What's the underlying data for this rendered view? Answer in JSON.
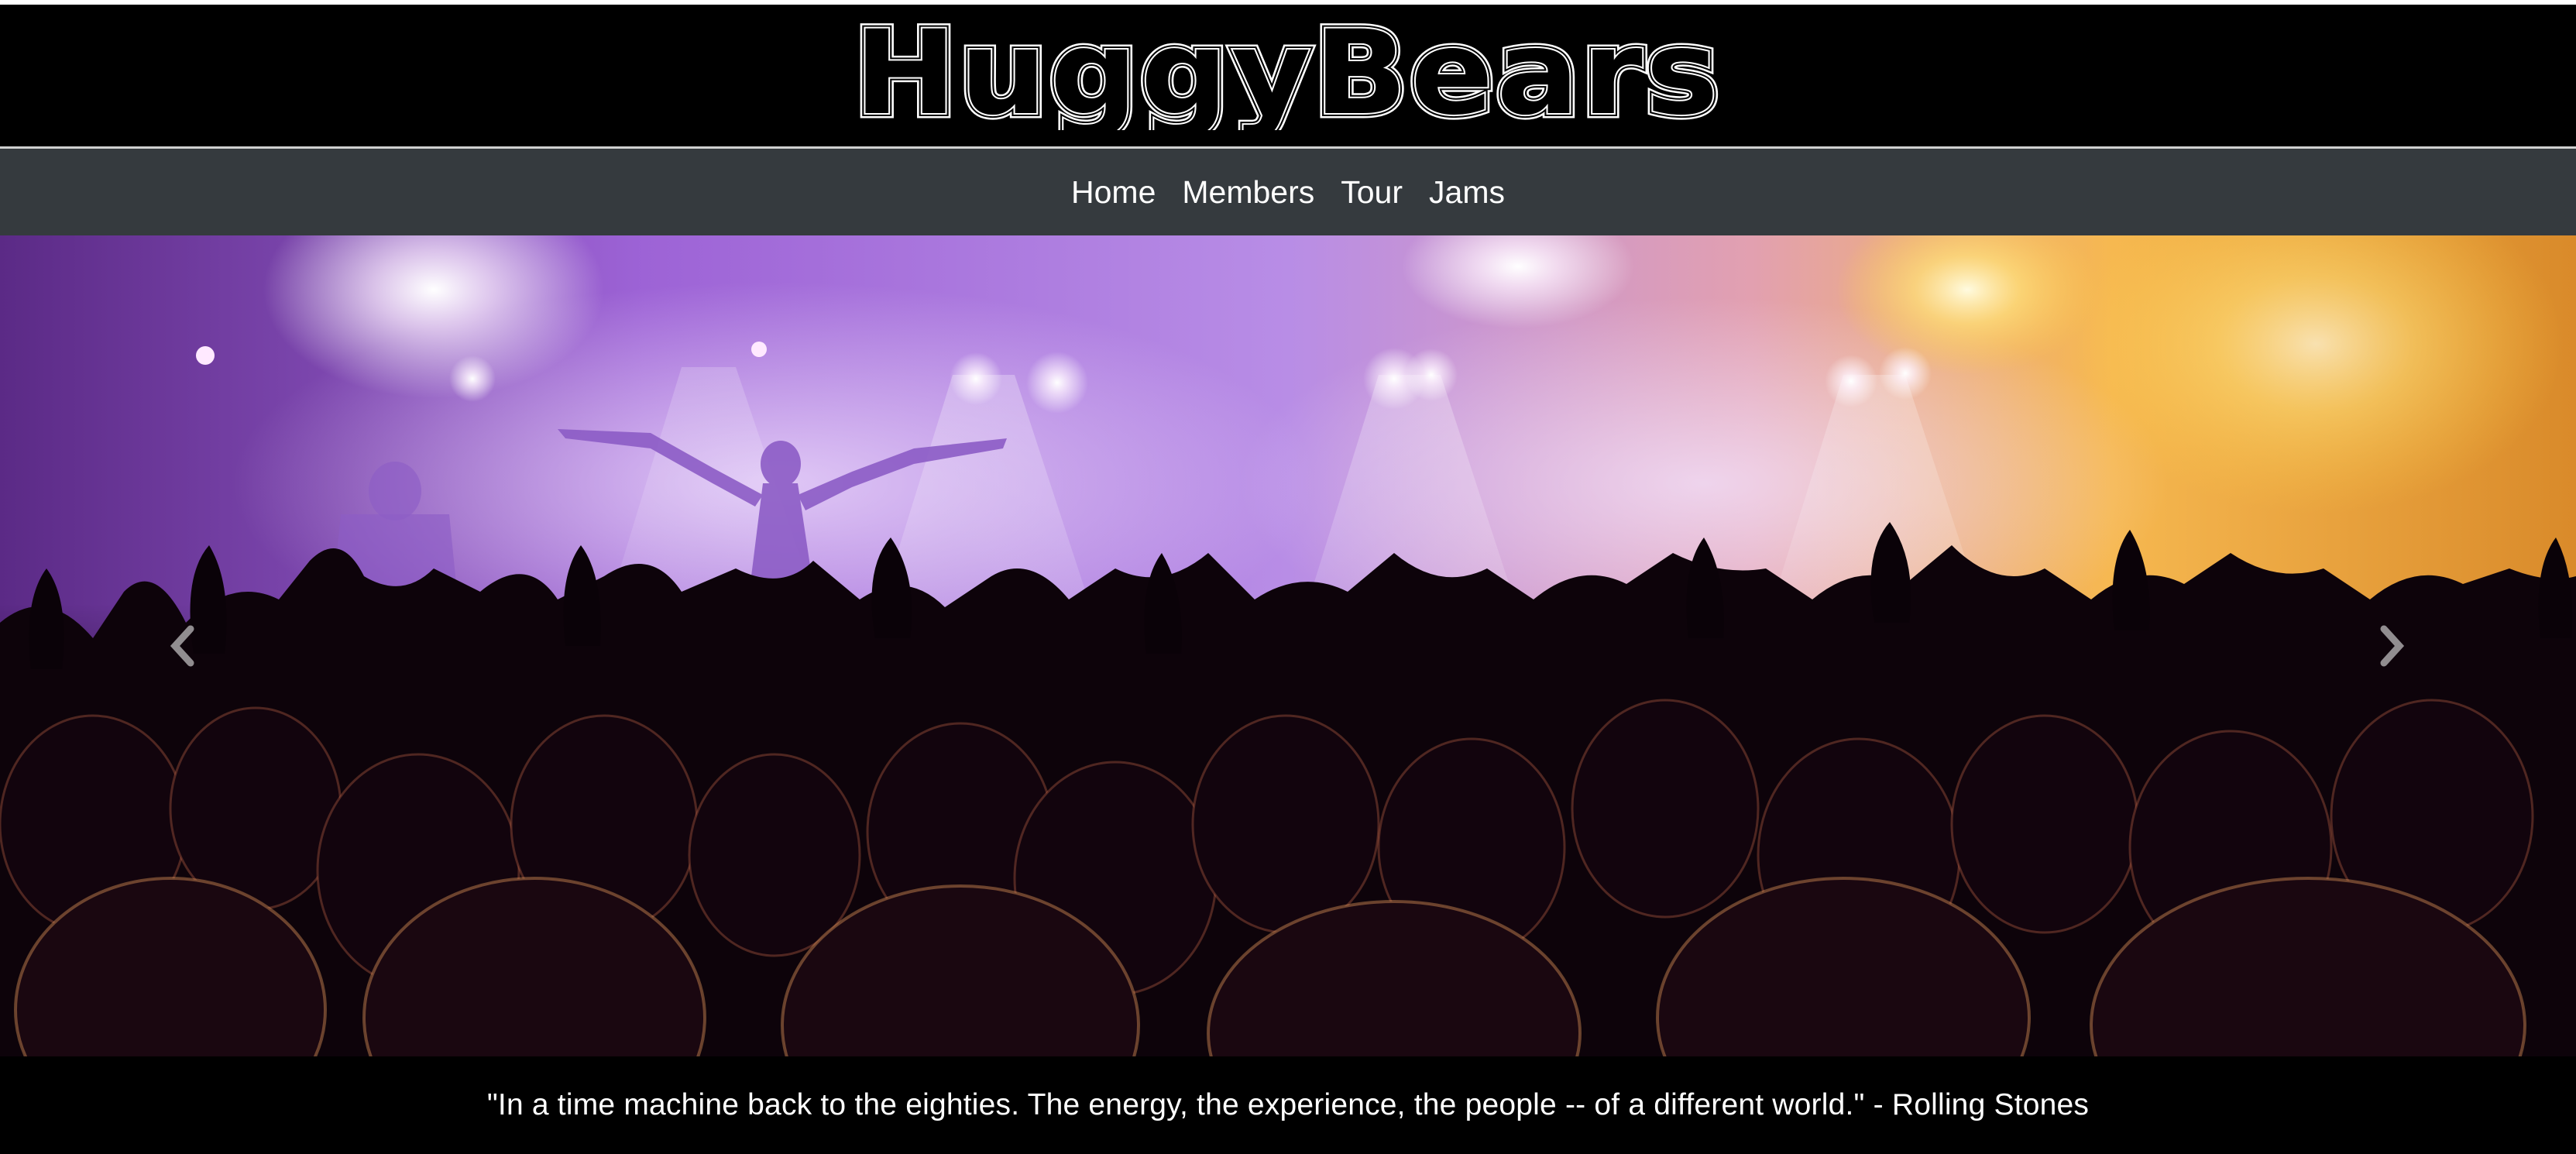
{
  "header": {
    "logo_text": "HuggyBears"
  },
  "nav": {
    "items": [
      {
        "label": "Home"
      },
      {
        "label": "Members"
      },
      {
        "label": "Tour"
      },
      {
        "label": "Jams"
      }
    ]
  },
  "carousel": {
    "prev_icon": "chevron-left-icon",
    "next_icon": "chevron-right-icon",
    "caption": "\"In a time machine back to the eighties. The energy, the experience, the people -- of a different world.\" - Rolling Stones"
  },
  "colors": {
    "header_bg": "#000000",
    "navbar_bg": "#353a3e",
    "stage_purple": "#a86ee0",
    "stage_orange": "#f5a23a",
    "caption_bg": "#000000"
  }
}
